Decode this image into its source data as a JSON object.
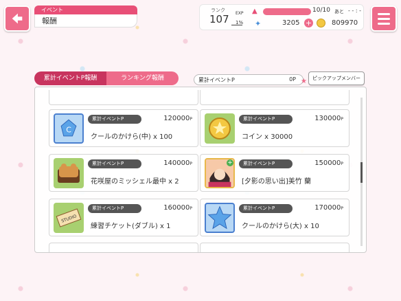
{
  "header": {
    "breadcrumb_top": "イベント",
    "breadcrumb_title": "報酬"
  },
  "status": {
    "rank_label": "ランク",
    "rank": "107",
    "exp_label": "EXP",
    "exp_percent": "1%",
    "exp_fraction": 0.01,
    "stamina": "10/10",
    "stamina_fraction": 1.0,
    "stamina_extra": "あと",
    "stamina_time": "- - : -",
    "stars": "3205",
    "coins": "809970"
  },
  "tabs": [
    {
      "label": "累計イベントP報酬"
    },
    {
      "label": "ランキング報酬"
    }
  ],
  "points": {
    "label": "累計イベントP",
    "value": "0P"
  },
  "pickup_label": "ピックアップメンバー",
  "rewards": [
    {
      "tag": "累計イベントP",
      "points": "120000",
      "unit": "P",
      "name": "クールのかけら(中) x 100",
      "icon": "cool-shard-medium-icon"
    },
    {
      "tag": "累計イベントP",
      "points": "130000",
      "unit": "P",
      "name": "コイン x 30000",
      "icon": "coin-icon"
    },
    {
      "tag": "累計イベントP",
      "points": "140000",
      "unit": "P",
      "name": "花咲屋のミッシェル最中 x 2",
      "icon": "michelle-monaka-icon"
    },
    {
      "tag": "累計イベントP",
      "points": "150000",
      "unit": "P",
      "name": "[夕影の思い出]美竹 蘭",
      "icon": "ran-card-icon"
    },
    {
      "tag": "累計イベントP",
      "points": "160000",
      "unit": "P",
      "name": "練習チケット(ダブル) x 1",
      "icon": "studio-ticket-icon"
    },
    {
      "tag": "累計イベントP",
      "points": "170000",
      "unit": "P",
      "name": "クールのかけら(大) x 10",
      "icon": "cool-shard-large-icon"
    }
  ],
  "colors": {
    "accent": "#ee6b8a",
    "accent_dark": "#c8345e",
    "pill": "#555555"
  }
}
